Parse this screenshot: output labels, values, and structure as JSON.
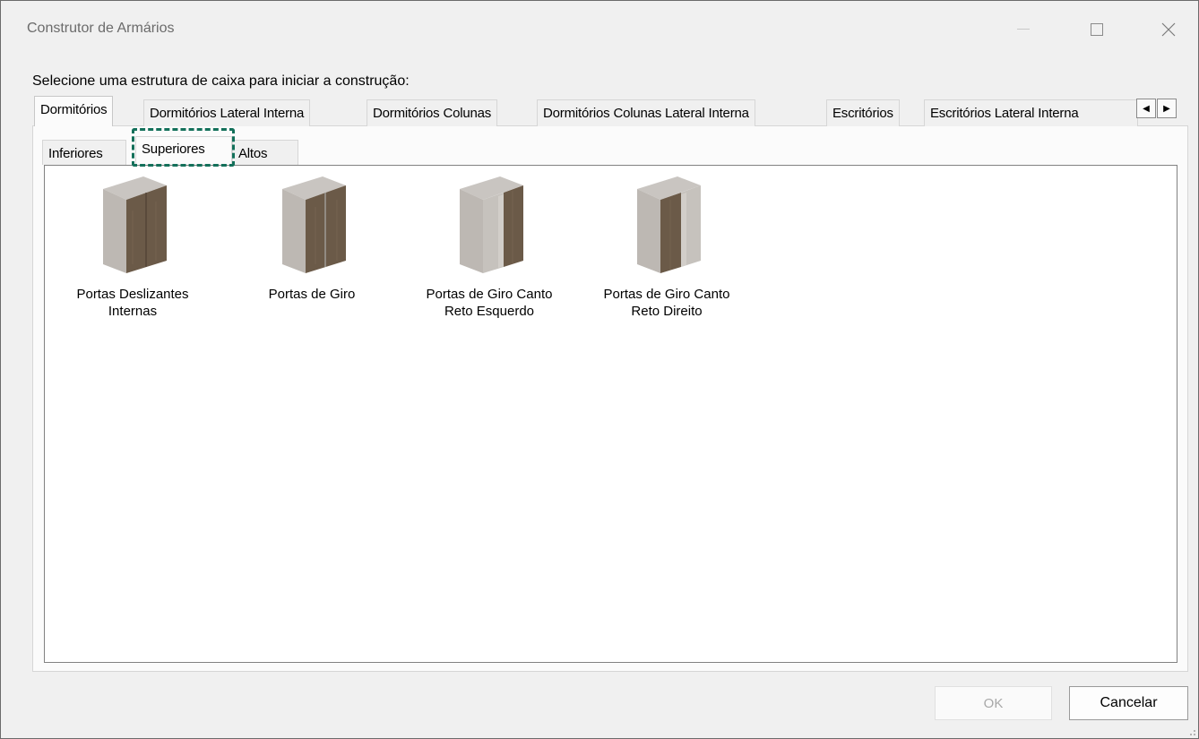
{
  "window": {
    "title": "Construtor de Armários"
  },
  "prompt": "Selecione uma estrutura de caixa para iniciar a construção:",
  "tabs": [
    {
      "label": "Dormitórios",
      "active": true
    },
    {
      "label": "Dormitórios Lateral Interna",
      "active": false
    },
    {
      "label": "Dormitórios Colunas",
      "active": false
    },
    {
      "label": "Dormitórios Colunas Lateral Interna",
      "active": false
    },
    {
      "label": "Escritórios",
      "active": false
    },
    {
      "label": "Escritórios Lateral Interna",
      "active": false
    }
  ],
  "subtabs": [
    {
      "label": "Inferiores",
      "active": false
    },
    {
      "label": "Superiores",
      "active": true
    },
    {
      "label": "Altos",
      "active": false
    }
  ],
  "items": [
    {
      "line1": "Portas Deslizantes",
      "line2": "Internas",
      "icon": "cabinet-sliding-doors-icon"
    },
    {
      "line1": "Portas de Giro",
      "line2": "",
      "icon": "cabinet-hinged-doors-icon"
    },
    {
      "line1": "Portas de Giro Canto",
      "line2": "Reto Esquerdo",
      "icon": "cabinet-corner-left-icon"
    },
    {
      "line1": "Portas de Giro Canto",
      "line2": "Reto Direito",
      "icon": "cabinet-corner-right-icon"
    }
  ],
  "buttons": {
    "ok": "OK",
    "cancel": "Cancelar"
  },
  "colors": {
    "highlight": "#13705a",
    "wood": "#6b5a48",
    "carcass": "#bdb8b3"
  }
}
